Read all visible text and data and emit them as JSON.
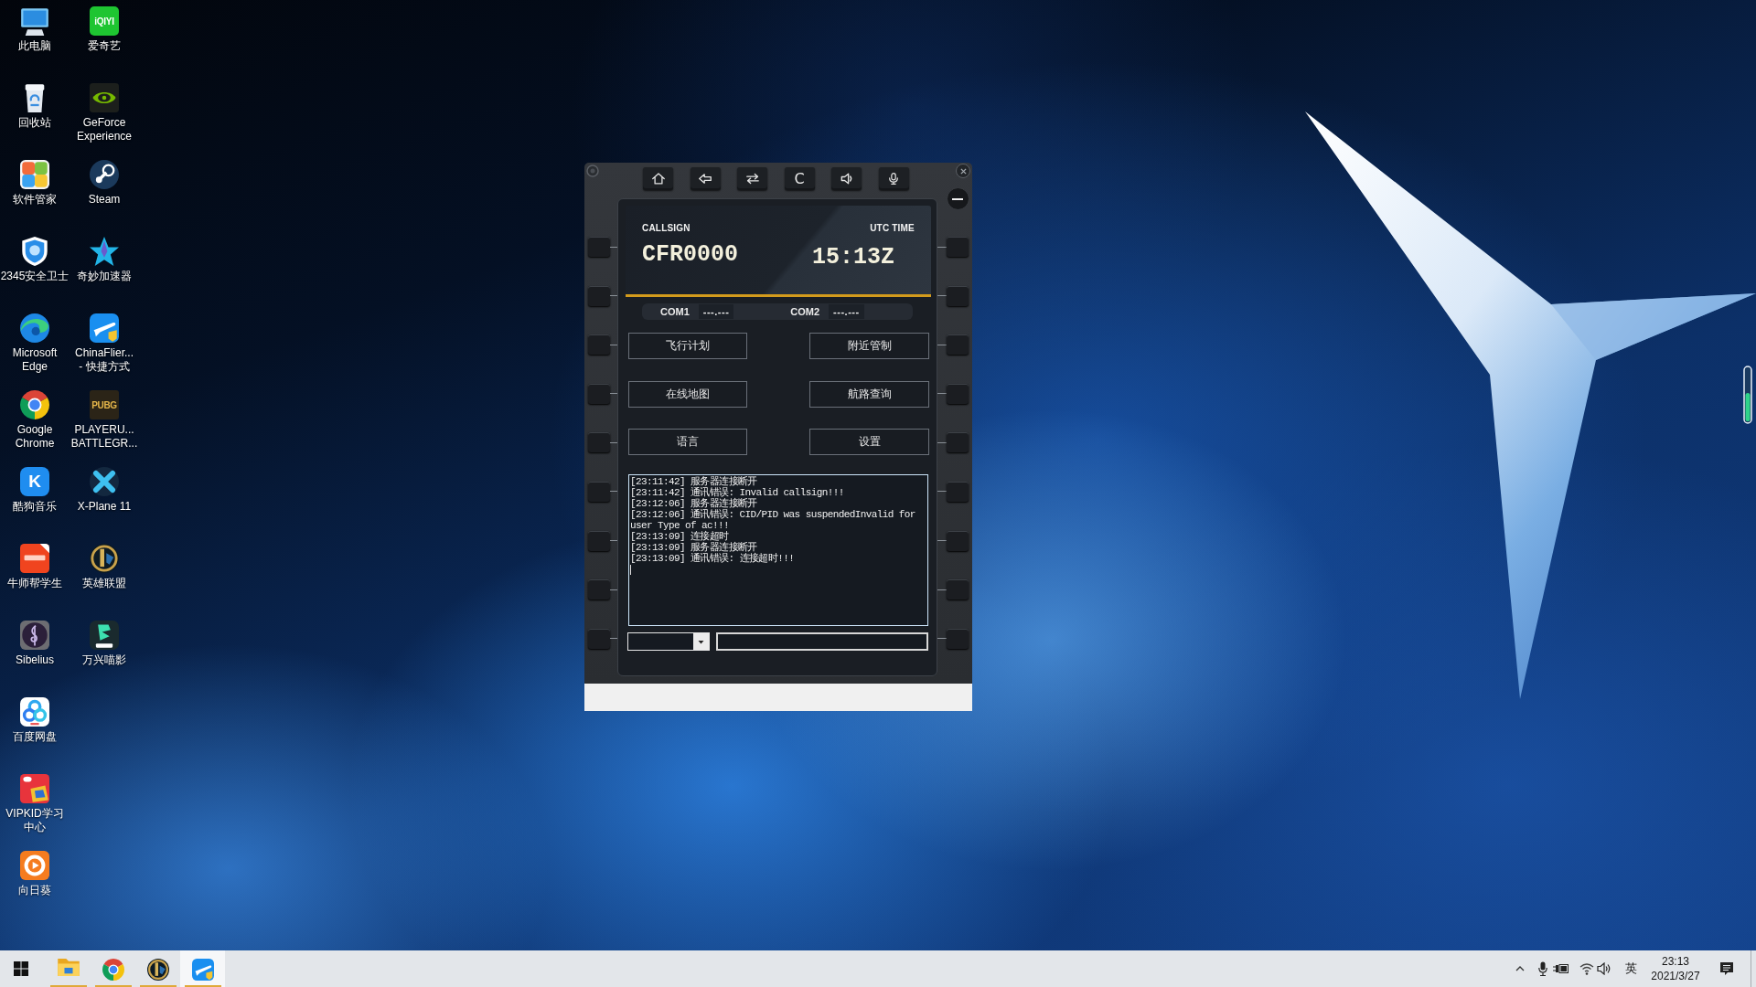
{
  "desktop": {
    "columns": [
      {
        "icons": [
          {
            "label": "此电脑"
          },
          {
            "label": "回收站"
          },
          {
            "label": "软件管家"
          },
          {
            "label": "2345安全卫士"
          },
          {
            "label": "Microsoft Edge"
          },
          {
            "label": "Google Chrome"
          },
          {
            "label": "酷狗音乐",
            "logo": "K"
          },
          {
            "label": "牛师帮学生"
          },
          {
            "label": "Sibelius"
          },
          {
            "label": "百度网盘"
          },
          {
            "label": "VIPKID学习中心"
          },
          {
            "label": "向日葵"
          }
        ]
      },
      {
        "icons": [
          {
            "label": "爱奇艺",
            "logo": "iQIYI"
          },
          {
            "label": "GeForce Experience"
          },
          {
            "label": "Steam"
          },
          {
            "label": "奇妙加速器"
          },
          {
            "label": "ChinaFlier...\n- 快捷方式"
          },
          {
            "label": "PLAYERU... BATTLEGR...",
            "logo": "PUBG"
          },
          {
            "label": "X-Plane 11"
          },
          {
            "label": "英雄联盟"
          },
          {
            "label": "万兴喵影"
          }
        ]
      }
    ]
  },
  "app_window": {
    "toolbar": [
      {
        "kind": "home"
      },
      {
        "kind": "back"
      },
      {
        "kind": "swap"
      },
      {
        "kind": "text",
        "label": "C"
      },
      {
        "kind": "speaker"
      },
      {
        "kind": "mic"
      }
    ],
    "display": {
      "callsign_label": "CALLSIGN",
      "callsign": "CFR0000",
      "utc_label": "UTC TIME",
      "utc_time": "15:13Z"
    },
    "radios": [
      {
        "label": "COM1",
        "frequency": "---.---"
      },
      {
        "label": "COM2",
        "frequency": "---.---"
      }
    ],
    "menu_buttons": [
      "飞行计划",
      "附近管制",
      "在线地图",
      "航路查询",
      "语言",
      "设置"
    ],
    "log": [
      "[23:11:42] 服务器连接断开",
      "[23:11:42] 通讯错误: Invalid callsign!!!",
      "[23:12:06] 服务器连接断开",
      "[23:12:06] 通讯错误: CID/PID was suspendedInvalid for user Type of ac!!!",
      "[23:13:09] 连接超时",
      "[23:13:09] 服务器连接断开",
      "[23:13:09] 通讯错误: 连接超时!!!"
    ]
  },
  "taskbar": {
    "apps": [
      {
        "selected": false,
        "running": true
      },
      {
        "selected": false,
        "running": true
      },
      {
        "selected": false,
        "running": true
      },
      {
        "selected": true,
        "running": true
      }
    ],
    "tray": {
      "input_method": "英",
      "time": "23:13",
      "date": "2021/3/27"
    }
  }
}
